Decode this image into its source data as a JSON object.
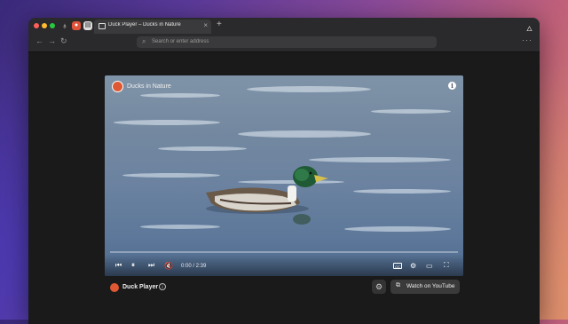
{
  "browser": {
    "tab": {
      "title": "Duck Player – Ducks in Nature",
      "close_label": "×"
    },
    "new_tab_label": "+",
    "address_placeholder": "Search or enter address"
  },
  "player": {
    "video_title": "Ducks in Nature",
    "time_display": "0:00 / 2:39",
    "progress": 0
  },
  "footer": {
    "title": "Duck Player",
    "watch_label": "Watch on YouTube"
  },
  "icons": {
    "logo": "duckduckgo-logo",
    "info": "info-icon",
    "controls": [
      "skip-back-icon",
      "pause-icon",
      "skip-forward-icon",
      "mute-icon",
      "captions-icon",
      "settings-icon",
      "airplay-icon",
      "fullscreen-icon"
    ]
  },
  "colors": {
    "accent": "#de5833",
    "background": "#1a1a1a"
  }
}
